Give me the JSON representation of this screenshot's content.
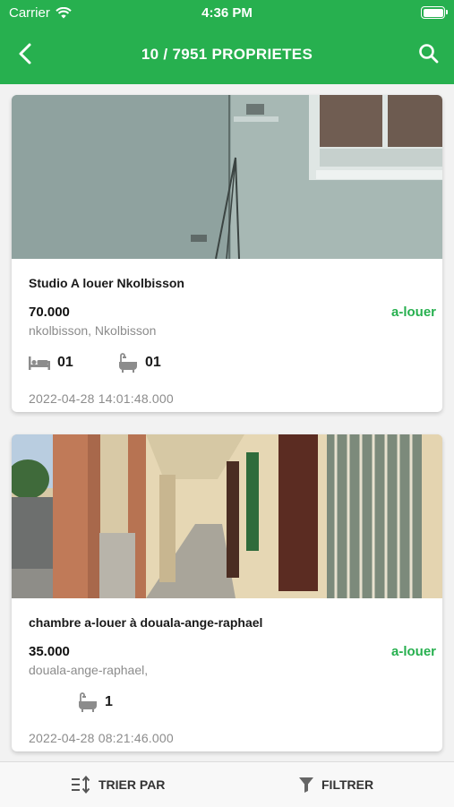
{
  "status_bar": {
    "carrier": "Carrier",
    "time": "4:36 PM"
  },
  "nav": {
    "title": "10 / 7951  PROPRIETES",
    "back_icon": "chevron-left-icon",
    "search_icon": "search-icon"
  },
  "listings": [
    {
      "title": "Studio A louer Nkolbisson",
      "price": "70.000",
      "status": "a-louer",
      "location": "nkolbisson, Nkolbisson",
      "bedrooms": "01",
      "bathrooms": "01",
      "date": "2022-04-28 14:01:48.000"
    },
    {
      "title": "chambre a-louer à douala-ange-raphael",
      "price": "35.000",
      "status": "a-louer",
      "location": "douala-ange-raphael,",
      "bathrooms": "1",
      "date": "2022-04-28 08:21:46.000"
    }
  ],
  "bottom_bar": {
    "sort_label": "TRIER PAR",
    "filter_label": "FILTRER"
  },
  "colors": {
    "primary": "#27b04f",
    "secondary_text": "#8c8c8c"
  }
}
